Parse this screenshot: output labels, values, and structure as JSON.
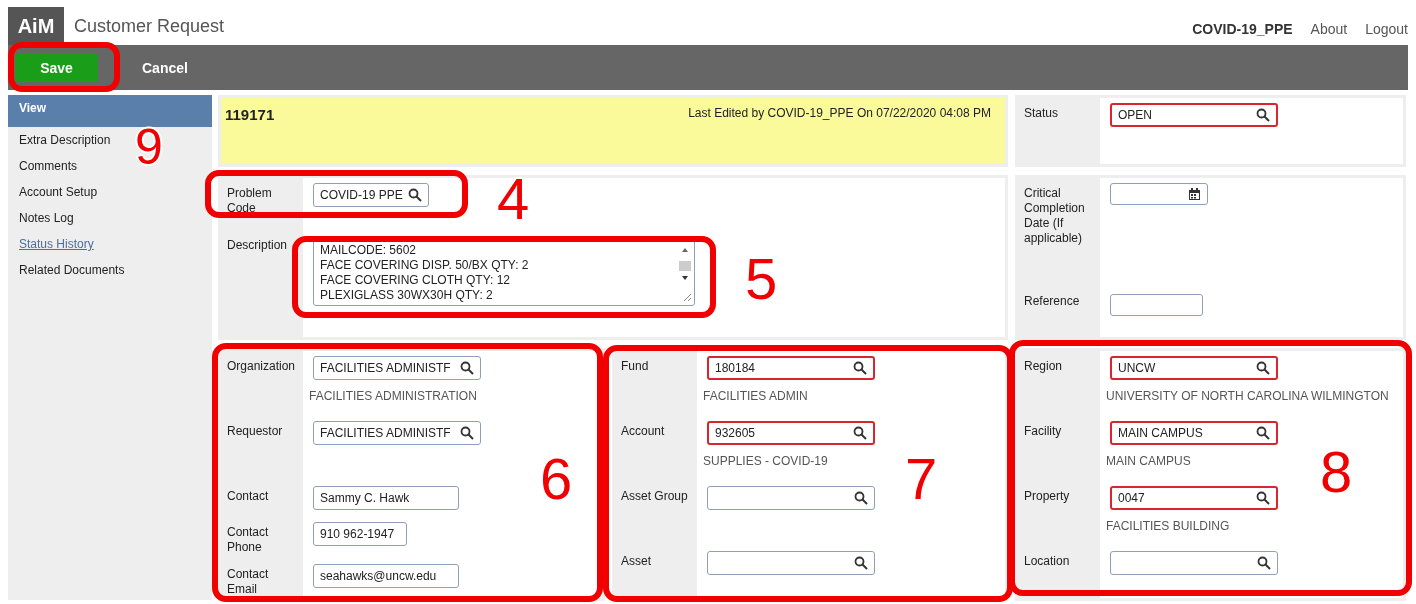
{
  "header": {
    "logo": "AiM",
    "title": "Customer Request",
    "user": "COVID-19_PPE",
    "links": [
      "About",
      "Logout"
    ]
  },
  "toolbar": {
    "buttons": [
      {
        "label": "Save",
        "kind": "primary"
      },
      {
        "label": "Cancel",
        "kind": "plain"
      }
    ]
  },
  "sidebar": {
    "items": [
      {
        "label": "View",
        "selected": true,
        "kind": "item"
      },
      {
        "label": "Extra Description",
        "selected": false,
        "kind": "item"
      },
      {
        "label": "Comments",
        "selected": false,
        "kind": "item"
      },
      {
        "label": "Account Setup",
        "selected": false,
        "kind": "item"
      },
      {
        "label": "Notes Log",
        "selected": false,
        "kind": "item"
      },
      {
        "label": "Status History",
        "selected": false,
        "kind": "link"
      },
      {
        "label": "Related Documents",
        "selected": false,
        "kind": "item"
      }
    ]
  },
  "record": {
    "number": "119171",
    "last_edited": "Last Edited by COVID-19_PPE On 07/22/2020 04:08 PM"
  },
  "panels": [
    {
      "fields": [
        {
          "kind": "lookup",
          "label": "Status",
          "value": "OPEN",
          "required": true
        }
      ]
    },
    {
      "fields": [
        {
          "kind": "lookup",
          "label": "Problem Code",
          "value": "COVID-19 PPE",
          "required": false
        },
        {
          "kind": "textarea",
          "label": "Description",
          "value": "MAILCODE: 5602\nFACE COVERING DISP. 50/BX QTY: 2\nFACE COVERING CLOTH QTY: 12\nPLEXIGLASS 30WX30H QTY: 2",
          "required": false
        }
      ]
    },
    {
      "fields": [
        {
          "kind": "date",
          "label": "Critical Completion Date (If applicable)",
          "required": false
        },
        {
          "kind": "text",
          "label": "Reference",
          "required": false
        }
      ]
    },
    {
      "fields": [
        {
          "kind": "lookup",
          "label": "Organization",
          "value": "FACILITIES ADMINISTF",
          "required": false
        },
        {
          "kind": "note",
          "value": "FACILITIES ADMINISTRATION"
        },
        {
          "kind": "lookup",
          "label": "Requestor",
          "value": "FACILITIES ADMINISTF",
          "required": false
        },
        {
          "kind": "note"
        },
        {
          "kind": "text",
          "label": "Contact",
          "value": "Sammy C. Hawk",
          "required": false
        },
        {
          "kind": "short",
          "label": "Contact Phone",
          "value": "910 962-1947",
          "required": false
        },
        {
          "kind": "text",
          "label": "Contact Email",
          "value": "seahawks@uncw.edu",
          "required": false
        }
      ]
    },
    {
      "fields": [
        {
          "kind": "lookup",
          "label": "Fund",
          "value": "180184",
          "required": true
        },
        {
          "kind": "note",
          "value": "FACILITIES ADMIN"
        },
        {
          "kind": "lookup",
          "label": "Account",
          "value": "932605",
          "required": true
        },
        {
          "kind": "note",
          "value": "SUPPLIES - COVID-19"
        },
        {
          "kind": "lookup",
          "label": "Asset Group",
          "required": false
        },
        {
          "kind": "note"
        },
        {
          "kind": "lookup",
          "label": "Asset",
          "required": false
        }
      ]
    },
    {
      "fields": [
        {
          "kind": "lookup",
          "label": "Region",
          "value": "UNCW",
          "required": true
        },
        {
          "kind": "note",
          "value": "UNIVERSITY OF NORTH CAROLINA WILMINGTON"
        },
        {
          "kind": "lookup",
          "label": "Facility",
          "value": "MAIN CAMPUS",
          "required": true
        },
        {
          "kind": "note",
          "value": "MAIN CAMPUS"
        },
        {
          "kind": "lookup",
          "label": "Property",
          "value": "0047",
          "required": true
        },
        {
          "kind": "note",
          "value": "FACILITIES BUILDING"
        },
        {
          "kind": "lookup",
          "label": "Location",
          "required": false
        }
      ]
    }
  ],
  "annotations": [
    {
      "label": "9"
    },
    {
      "label": "4"
    },
    {
      "label": "5"
    },
    {
      "label": "6"
    },
    {
      "label": "7"
    },
    {
      "label": "8"
    }
  ]
}
